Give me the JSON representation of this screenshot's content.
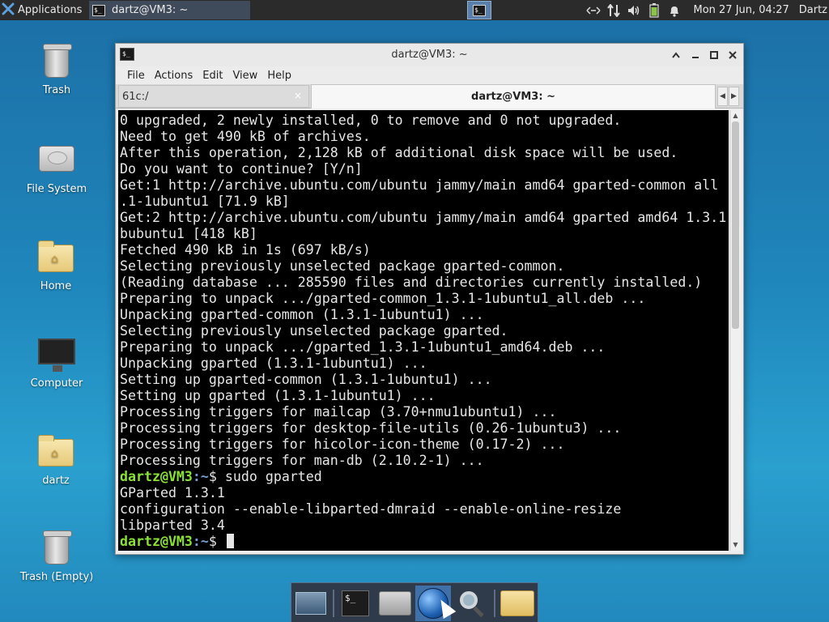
{
  "top_panel": {
    "applications_label": "Applications",
    "task_title": "dartz@VM3: ~",
    "clock": "Mon 27 Jun, 04:27",
    "user": "Dartz",
    "icons": [
      "network-icon",
      "transfer-icon",
      "volume-icon",
      "battery-icon",
      "notification-bell-icon"
    ]
  },
  "desktop": {
    "icons": [
      {
        "label": "Trash",
        "icon": "trash-icon"
      },
      {
        "label": "File System",
        "icon": "hard-disk-icon"
      },
      {
        "label": "Home",
        "icon": "home-folder-icon"
      },
      {
        "label": "Computer",
        "icon": "monitor-icon"
      },
      {
        "label": "dartz",
        "icon": "home-folder-icon"
      },
      {
        "label": "Trash (Empty)",
        "icon": "trash-icon"
      }
    ]
  },
  "window": {
    "title": "dartz@VM3: ~",
    "menu": [
      "File",
      "Actions",
      "Edit",
      "View",
      "Help"
    ],
    "tabs": [
      {
        "label": "61c:/",
        "active": false
      },
      {
        "label": "dartz@VM3: ~",
        "active": true
      }
    ],
    "close_symbol": "×",
    "terminal_lines": [
      "0 upgraded, 2 newly installed, 0 to remove and 0 not upgraded.",
      "Need to get 490 kB of archives.",
      "After this operation, 2,128 kB of additional disk space will be used.",
      "Do you want to continue? [Y/n]",
      "Get:1 http://archive.ubuntu.com/ubuntu jammy/main amd64 gparted-common all",
      ".1-1ubuntu1 [71.9 kB]",
      "Get:2 http://archive.ubuntu.com/ubuntu jammy/main amd64 gparted amd64 1.3.1",
      "bubuntu1 [418 kB]",
      "Fetched 490 kB in 1s (697 kB/s)",
      "Selecting previously unselected package gparted-common.",
      "(Reading database ... 285590 files and directories currently installed.)",
      "Preparing to unpack .../gparted-common_1.3.1-1ubuntu1_all.deb ...",
      "Unpacking gparted-common (1.3.1-1ubuntu1) ...",
      "Selecting previously unselected package gparted.",
      "Preparing to unpack .../gparted_1.3.1-1ubuntu1_amd64.deb ...",
      "Unpacking gparted (1.3.1-1ubuntu1) ...",
      "Setting up gparted-common (1.3.1-1ubuntu1) ...",
      "Setting up gparted (1.3.1-1ubuntu1) ...",
      "Processing triggers for mailcap (3.70+nmu1ubuntu1) ...",
      "Processing triggers for desktop-file-utils (0.26-1ubuntu3) ...",
      "Processing triggers for hicolor-icon-theme (0.17-2) ...",
      "Processing triggers for man-db (2.10.2-1) ..."
    ],
    "prompt_user": "dartz@VM3",
    "prompt_path": ":~",
    "prompt_symbol": "$ ",
    "command": "sudo gparted",
    "output_lines": [
      "GParted 1.3.1",
      "configuration --enable-libparted-dmraid --enable-online-resize",
      "libparted 3.4"
    ]
  },
  "dock": {
    "items": [
      "show-desktop-icon",
      "terminal-icon",
      "home-folder-icon",
      "web-browser-icon",
      "search-icon",
      "folder-icon"
    ]
  },
  "colors": {
    "prompt_user": "#8ae234",
    "prompt_path": "#729fcf",
    "terminal_bg": "#000000",
    "panel_bg": "#2b2b2b"
  }
}
